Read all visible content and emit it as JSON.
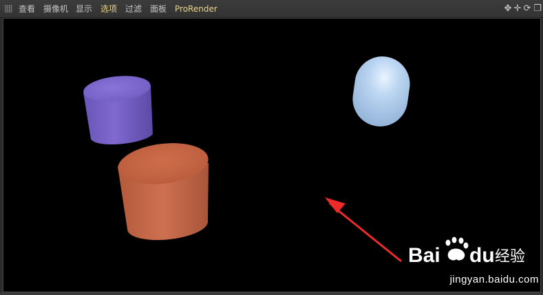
{
  "menubar": {
    "items": [
      {
        "label": "查看"
      },
      {
        "label": "摄像机"
      },
      {
        "label": "显示"
      },
      {
        "label": "选项"
      },
      {
        "label": "过滤"
      },
      {
        "label": "面板"
      },
      {
        "label": "ProRender"
      }
    ],
    "active_item": "选项",
    "active_color": "#e9d58a",
    "text_color": "#c6c6c6",
    "icons": [
      "move-icon",
      "pan-icon",
      "rotate-icon",
      "maximize-icon"
    ],
    "icon_glyphs": [
      "✥",
      "✛",
      "⟳",
      "❐"
    ]
  },
  "viewport": {
    "background": "#000000",
    "objects": [
      {
        "name": "purple-cylinder",
        "color": "#7b64c8"
      },
      {
        "name": "orange-cylinder",
        "color": "#c86a45"
      },
      {
        "name": "blue-capsule",
        "color": "#a9c8ea"
      }
    ],
    "annotation_arrow_color": "#ee2b2b"
  },
  "watermark": {
    "logo_text": "Bai du 经验",
    "url": "jingyan.baidu.com"
  }
}
